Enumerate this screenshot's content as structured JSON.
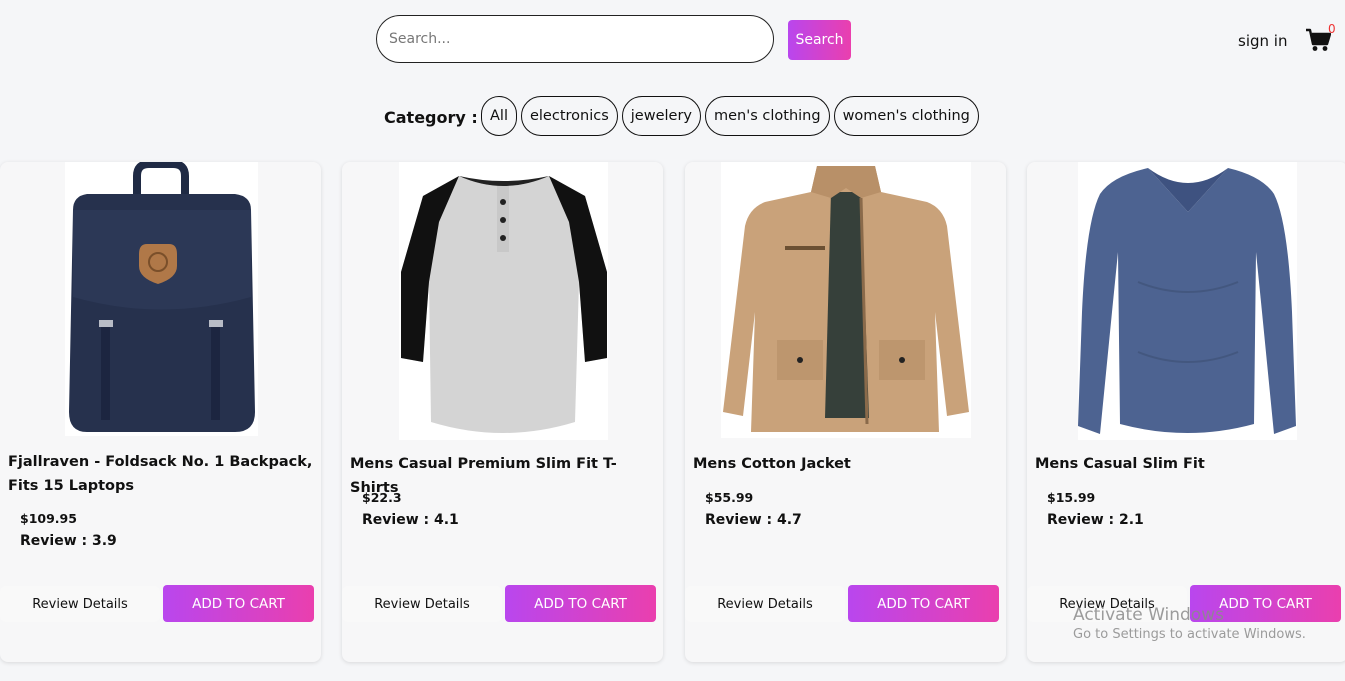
{
  "header": {
    "search_placeholder": "Search...",
    "search_button": "Search",
    "signin": "sign in",
    "cart_count": "0"
  },
  "category": {
    "label": "Category :",
    "options": [
      "All",
      "electronics",
      "jewelery",
      "men's clothing",
      "women's clothing"
    ]
  },
  "products": [
    {
      "title": "Fjallraven - Foldsack No. 1 Backpack, Fits 15 Laptops",
      "price": "$109.95",
      "review": "Review : 3.9",
      "review_btn": "Review Details",
      "cart_btn": "ADD TO CART",
      "image": "backpack"
    },
    {
      "title": "Mens Casual Premium Slim Fit T-Shirts",
      "price": "$22.3",
      "review": "Review : 4.1",
      "review_btn": "Review Details",
      "cart_btn": "ADD TO CART",
      "image": "raglan-tshirt"
    },
    {
      "title": "Mens Cotton Jacket",
      "price": "$55.99",
      "review": "Review : 4.7",
      "review_btn": "Review Details",
      "cart_btn": "ADD TO CART",
      "image": "cotton-jacket"
    },
    {
      "title": "Mens Casual Slim Fit",
      "price": "$15.99",
      "review": "Review : 2.1",
      "review_btn": "Review Details",
      "cart_btn": "ADD TO CART",
      "image": "longsleeve-shirt"
    }
  ],
  "watermark": {
    "title": "Activate Windows",
    "subtitle": "Go to Settings to activate Windows."
  },
  "colors": {
    "accent_start": "#b946ee",
    "accent_end": "#ea3fae",
    "cart_badge": "#e33333"
  }
}
